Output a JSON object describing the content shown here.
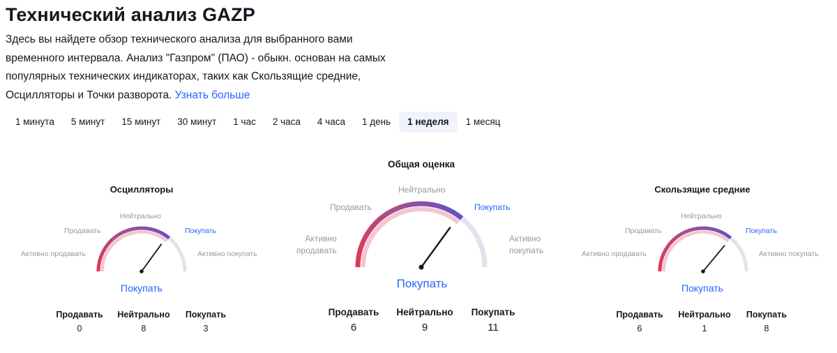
{
  "page": {
    "title": "Технический анализ GAZP",
    "description": "Здесь вы найдете обзор технического анализа для выбранного вами временного интервала. Анализ \"Газпром\" (ПАО) - обыкн. основан на самых популярных технических индикаторах, таких как Скользящие средние, Осцилляторы и Точки разворота.",
    "learn_more": "Узнать больше"
  },
  "tabs": [
    {
      "label": "1 минута",
      "active": false
    },
    {
      "label": "5 минут",
      "active": false
    },
    {
      "label": "15 минут",
      "active": false
    },
    {
      "label": "30 минут",
      "active": false
    },
    {
      "label": "1 час",
      "active": false
    },
    {
      "label": "2 часа",
      "active": false
    },
    {
      "label": "4 часа",
      "active": false
    },
    {
      "label": "1 день",
      "active": false
    },
    {
      "label": "1 неделя",
      "active": true
    },
    {
      "label": "1 месяц",
      "active": false
    }
  ],
  "gauges": {
    "oscillators": {
      "title": "Осцилляторы",
      "strong_sell": "Активно продавать",
      "sell": "Продавать",
      "neutral": "Нейтрально",
      "buy": "Покупать",
      "strong_buy": "Активно покупать",
      "verdict": "Покупать",
      "needle_level": 0.7,
      "counts": [
        {
          "label": "Продавать",
          "value": "0"
        },
        {
          "label": "Нейтрально",
          "value": "8"
        },
        {
          "label": "Покупать",
          "value": "3"
        }
      ]
    },
    "summary": {
      "title": "Общая оценка",
      "strong_sell_1": "Активно",
      "strong_sell_2": "продавать",
      "sell": "Продавать",
      "neutral": "Нейтрально",
      "buy": "Покупать",
      "strong_buy_1": "Активно",
      "strong_buy_2": "покупать",
      "verdict": "Покупать",
      "needle_level": 0.7,
      "counts": [
        {
          "label": "Продавать",
          "value": "6"
        },
        {
          "label": "Нейтрально",
          "value": "9"
        },
        {
          "label": "Покупать",
          "value": "11"
        }
      ]
    },
    "moving_averages": {
      "title": "Скользящие средние",
      "strong_sell": "Активно продавать",
      "sell": "Продавать",
      "neutral": "Нейтрально",
      "buy": "Покупать",
      "strong_buy": "Активно покупать",
      "verdict": "Покупать",
      "needle_level": 0.72,
      "counts": [
        {
          "label": "Продавать",
          "value": "6"
        },
        {
          "label": "Нейтрально",
          "value": "1"
        },
        {
          "label": "Покупать",
          "value": "8"
        }
      ]
    }
  },
  "colors": {
    "accent": "#2962ff",
    "muted_label": "#9598a1",
    "track": "#e0e3eb",
    "sell_red": "#e03950",
    "neutral_mid": "#a84f8e",
    "buy_purple": "#6a4fc2",
    "needle": "#131722"
  }
}
